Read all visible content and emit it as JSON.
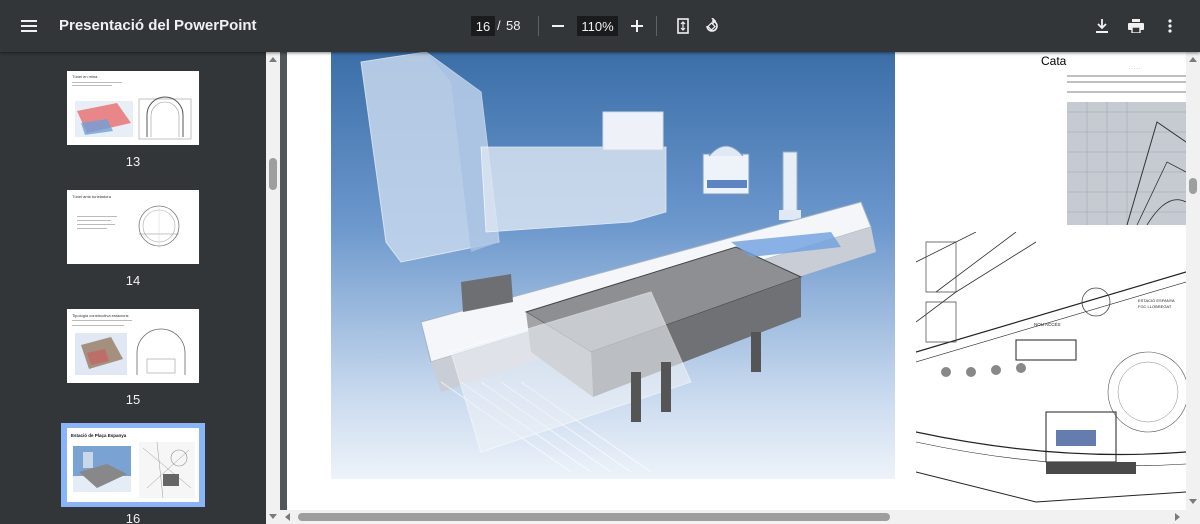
{
  "toolbar": {
    "title": "Presentació del PowerPoint",
    "current_page": "16",
    "separator": "/",
    "total_pages": "58",
    "zoom": "110%",
    "icons": [
      "menu-icon",
      "zoom-out-icon",
      "zoom-in-icon",
      "fit-page-icon",
      "rotate-icon",
      "download-icon",
      "print-icon",
      "more-icon"
    ]
  },
  "sidebar": {
    "thumbnails": [
      {
        "number": "13",
        "title": "Túnel en mina"
      },
      {
        "number": "14",
        "title": "Túnel amb tuneladora"
      },
      {
        "number": "15",
        "title": "Tipologia constructiva estacions"
      },
      {
        "number": "16",
        "title": "Estació de Plaça Espanya",
        "selected": true
      }
    ]
  },
  "document": {
    "label": "Catalanes"
  },
  "colors": {
    "toolbar_bg": "#323639",
    "viewer_bg": "#525659",
    "selected_thumb": "#8ab4f8"
  }
}
